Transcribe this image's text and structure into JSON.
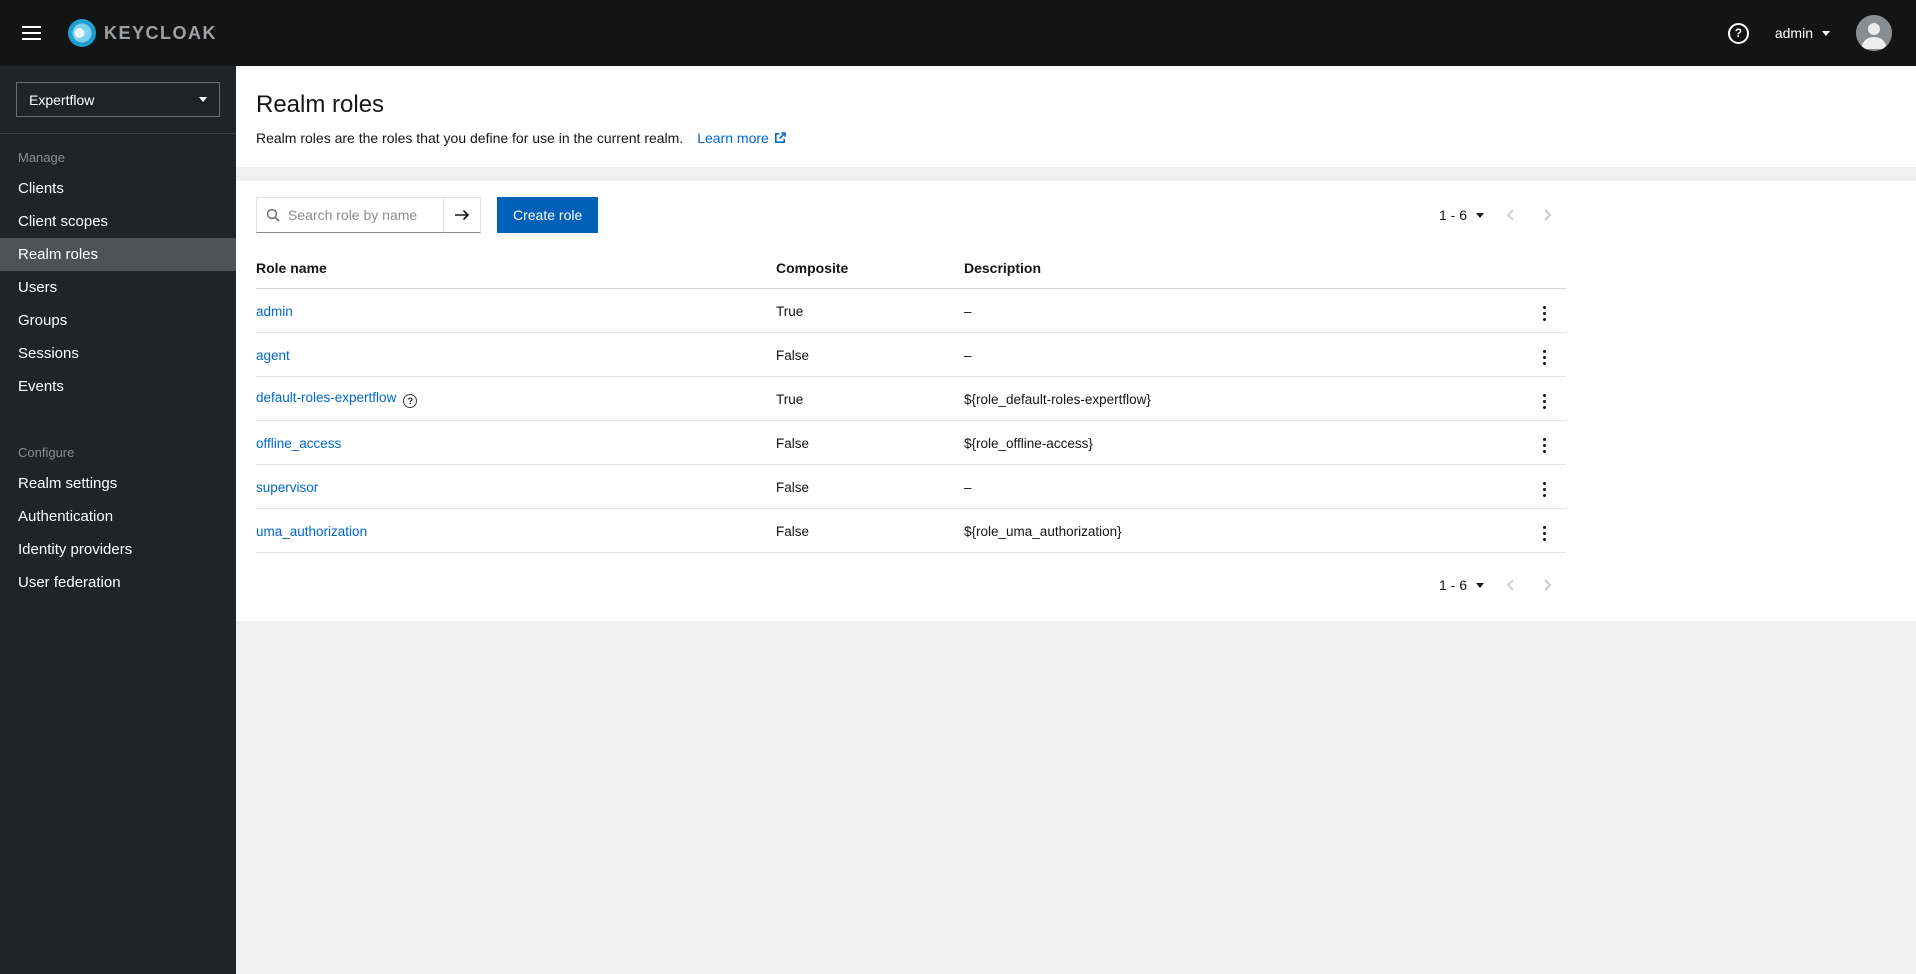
{
  "colors": {
    "accent": "#0060b8",
    "link": "#0066cc",
    "masthead_bg": "#141414",
    "sidebar_bg": "#212427",
    "sidebar_selected_bg": "#4f5255",
    "main_bg": "#f0f0f0"
  },
  "icons": {
    "question_mark": "?"
  },
  "masthead": {
    "brand": "KEYCLOAK",
    "user_menu": {
      "label": "admin"
    }
  },
  "sidebar": {
    "realm_selector": {
      "value": "Expertflow"
    },
    "sections": [
      {
        "label": "Manage",
        "items": [
          {
            "label": "Clients"
          },
          {
            "label": "Client scopes"
          },
          {
            "label": "Realm roles"
          },
          {
            "label": "Users"
          },
          {
            "label": "Groups"
          },
          {
            "label": "Sessions"
          },
          {
            "label": "Events"
          }
        ]
      },
      {
        "label": "Configure",
        "items": [
          {
            "label": "Realm settings"
          },
          {
            "label": "Authentication"
          },
          {
            "label": "Identity providers"
          },
          {
            "label": "User federation"
          }
        ]
      }
    ]
  },
  "page_header": {
    "title": "Realm roles",
    "description": "Realm roles are the roles that you define for use in the current realm.",
    "learn_more_label": "Learn more"
  },
  "toolbar": {
    "search": {
      "placeholder": "Search role by name"
    },
    "create_button_label": "Create role"
  },
  "pagination": {
    "range_label": "1 - 6"
  },
  "roles_table": {
    "columns": [
      "Role name",
      "Composite",
      "Description"
    ],
    "rows": [
      {
        "name": "admin",
        "composite": "True",
        "description": "–"
      },
      {
        "name": "agent",
        "composite": "False",
        "description": "–"
      },
      {
        "name": "default-roles-expertflow",
        "composite": "True",
        "description": "${role_default-roles-expertflow}"
      },
      {
        "name": "offline_access",
        "composite": "False",
        "description": "${role_offline-access}"
      },
      {
        "name": "supervisor",
        "composite": "False",
        "description": "–"
      },
      {
        "name": "uma_authorization",
        "composite": "False",
        "description": "${role_uma_authorization}"
      }
    ]
  }
}
